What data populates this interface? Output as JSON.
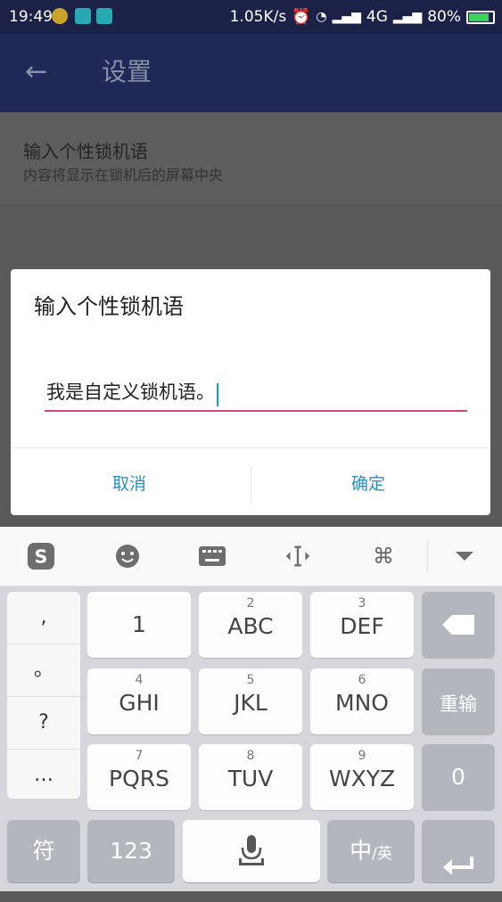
{
  "status_bar": {
    "time": "19:49",
    "speed": "1.05K/s",
    "network": "4G",
    "battery": "80%"
  },
  "app_bar": {
    "title": "设置"
  },
  "setting": {
    "title": "输入个性锁机语",
    "subtitle": "内容将显示在锁机后的屏幕中央"
  },
  "dialog": {
    "title": "输入个性锁机语",
    "input_value": "我是自定义锁机语。",
    "cancel": "取消",
    "ok": "确定"
  },
  "keyboard": {
    "punct": [
      ",",
      "。",
      "?",
      "…"
    ],
    "rows": [
      [
        {
          "n": "",
          "l": "1"
        },
        {
          "n": "2",
          "l": "ABC"
        },
        {
          "n": "3",
          "l": "DEF"
        }
      ],
      [
        {
          "n": "4",
          "l": "GHI"
        },
        {
          "n": "5",
          "l": "JKL"
        },
        {
          "n": "6",
          "l": "MNO"
        }
      ],
      [
        {
          "n": "7",
          "l": "PQRS"
        },
        {
          "n": "8",
          "l": "TUV"
        },
        {
          "n": "9",
          "l": "WXYZ"
        }
      ]
    ],
    "reenter": "重输",
    "zero": "0",
    "symbol": "符",
    "num": "123",
    "lang_main": "中",
    "lang_sub": "/英"
  }
}
